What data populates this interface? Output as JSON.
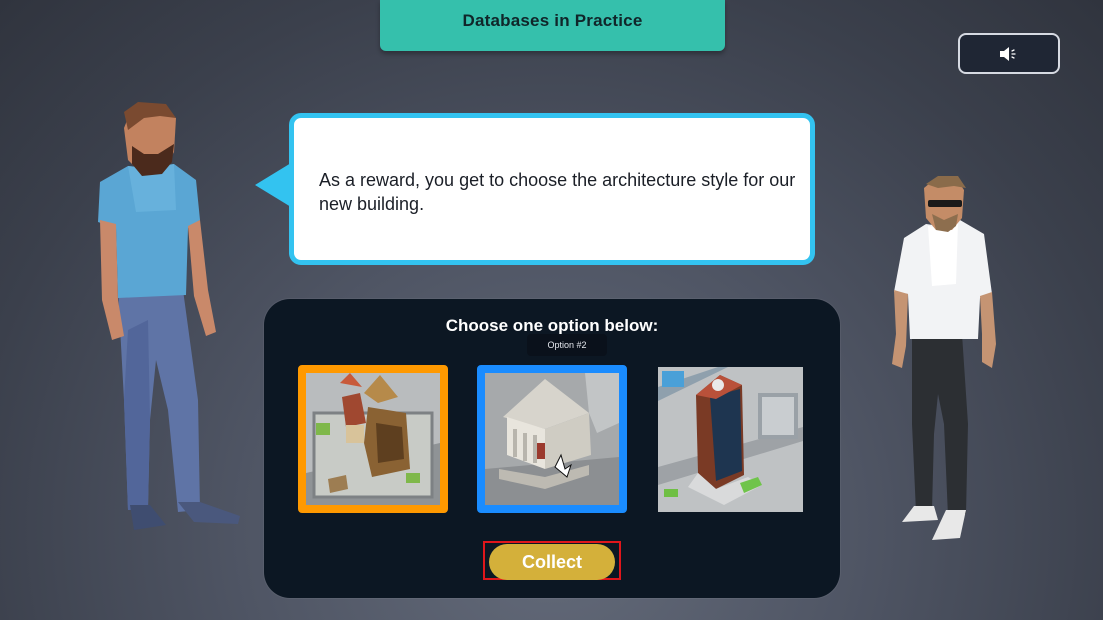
{
  "header": {
    "title": "Databases in Practice"
  },
  "sound": {
    "icon": "speaker-icon"
  },
  "dialogue": {
    "text": "As a reward, you get to choose the architecture style for our new building."
  },
  "choice_panel": {
    "title": "Choose one option below:",
    "tooltip": "Option #2",
    "options": [
      {
        "selected": true,
        "border_color": "#ff9900",
        "image": "medieval-town-house"
      },
      {
        "selected": false,
        "border_color": "#1a8cff",
        "image": "classical-columned-building",
        "hovered": true
      },
      {
        "selected": false,
        "image": "modern-skyscraper"
      }
    ],
    "collect_label": "Collect"
  },
  "colors": {
    "banner": "#35c0ac",
    "bubble_border": "#33c3f0",
    "panel": "#0c1723",
    "collect": "#d4b03a",
    "highlight": "#e0161b"
  }
}
